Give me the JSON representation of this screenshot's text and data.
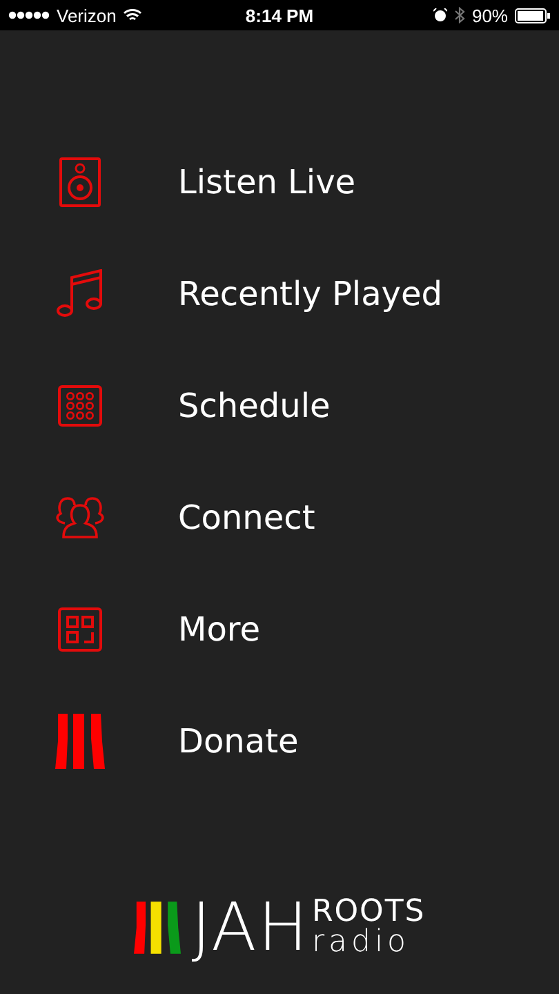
{
  "status_bar": {
    "carrier": "Verizon",
    "time": "8:14 PM",
    "battery": "90%"
  },
  "menu": [
    {
      "label": "Listen Live",
      "kind": "speaker"
    },
    {
      "label": "Recently Played",
      "kind": "music"
    },
    {
      "label": "Schedule",
      "kind": "grid"
    },
    {
      "label": "Connect",
      "kind": "people"
    },
    {
      "label": "More",
      "kind": "qr"
    },
    {
      "label": "Donate",
      "kind": "stripes"
    }
  ],
  "logo": {
    "main": "JAH",
    "top": "ROOTS",
    "bottom": "radio"
  }
}
